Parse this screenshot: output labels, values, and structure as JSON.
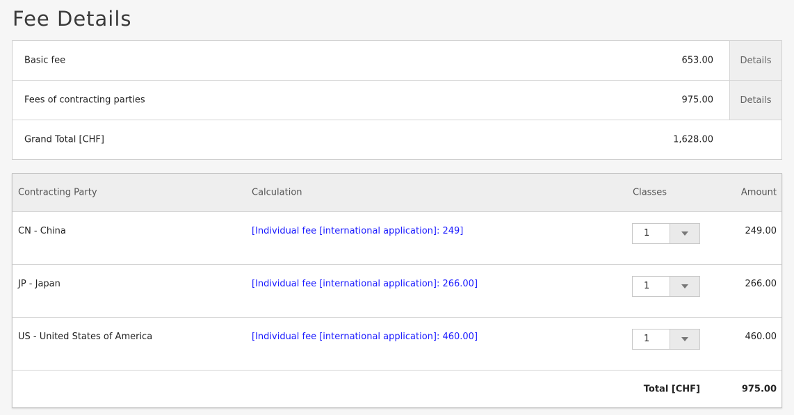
{
  "page": {
    "title": "Fee Details"
  },
  "summary": {
    "rows": [
      {
        "label": "Basic fee",
        "value": "653.00",
        "details": "Details"
      },
      {
        "label": "Fees of contracting parties",
        "value": "975.00",
        "details": "Details"
      },
      {
        "label": "Grand Total [CHF]",
        "value": "1,628.00"
      }
    ]
  },
  "parties": {
    "headers": {
      "party": "Contracting Party",
      "calculation": "Calculation",
      "classes": "Classes",
      "amount": "Amount"
    },
    "rows": [
      {
        "party": "CN - China",
        "calculation": "[Individual fee [international application]: 249]",
        "classes": "1",
        "amount": "249.00"
      },
      {
        "party": "JP - Japan",
        "calculation": "[Individual fee [international application]: 266.00]",
        "classes": "1",
        "amount": "266.00"
      },
      {
        "party": "US - United States of America",
        "calculation": "[Individual fee [international application]: 460.00]",
        "classes": "1",
        "amount": "460.00"
      }
    ],
    "total": {
      "label": "Total [CHF]",
      "value": "975.00"
    }
  },
  "colors": {
    "link": "#1a1aff",
    "header_bg": "#eeeeee",
    "details_bg": "#efefef"
  }
}
